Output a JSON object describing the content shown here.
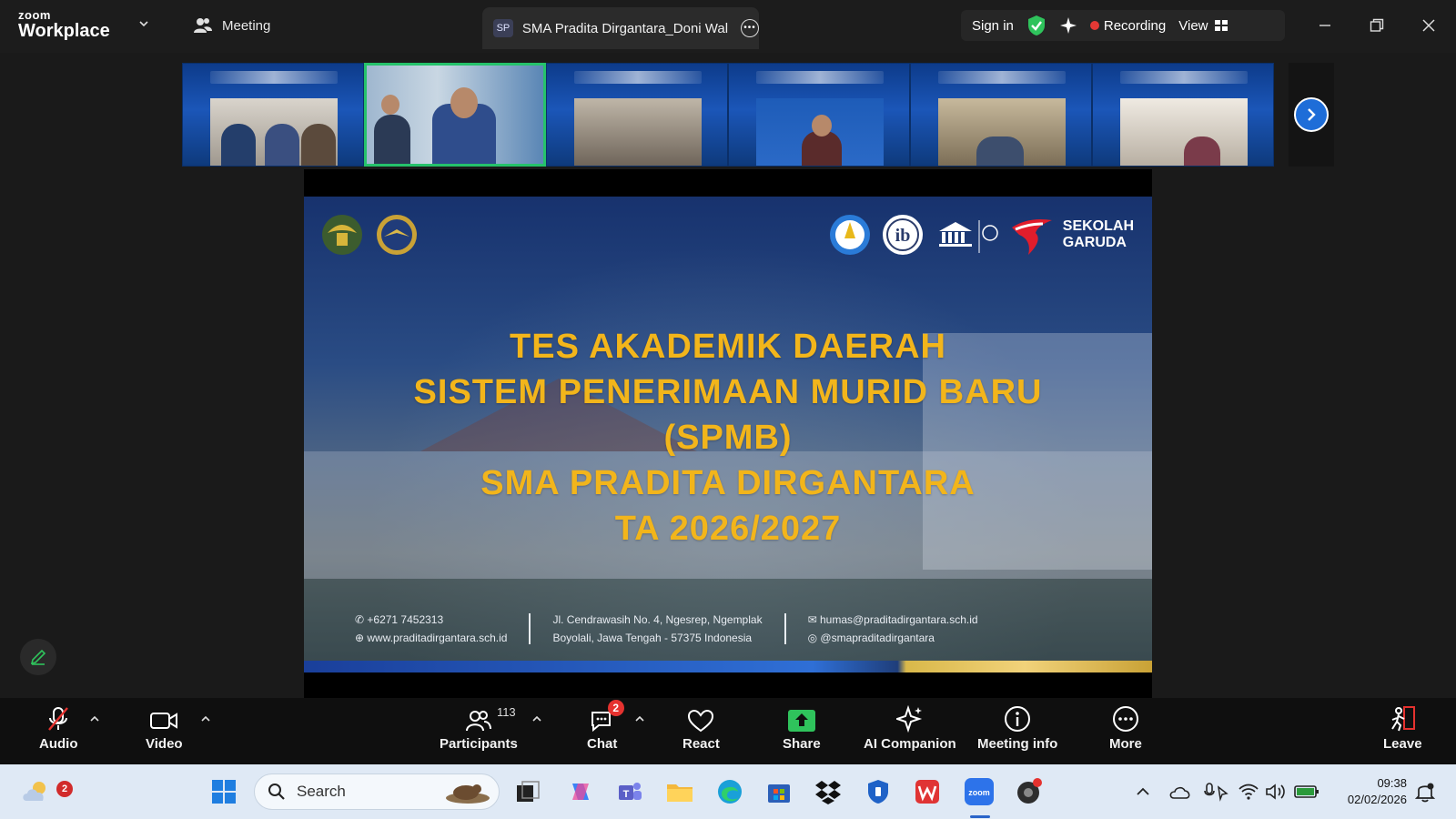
{
  "app": {
    "brand_top": "zoom",
    "brand_bottom": "Workplace",
    "meeting_tab_label": "Meeting",
    "meeting_title_badge": "SP",
    "meeting_title": "SMA Pradita Dirgantara_Doni Wal",
    "sign_in": "Sign in",
    "recording": "Recording",
    "view": "View",
    "accent": "#25c26b",
    "record_color": "#e53935"
  },
  "slide": {
    "title_lines": [
      "TES AKADEMIK DAERAH",
      "SISTEM PENERIMAAN MURID BARU",
      "(SPMB)",
      "SMA PRADITA DIRGANTARA",
      "TA 2026/2027"
    ],
    "title_color": "#f2b51b",
    "logo_right_text_1": "SEKOLAH",
    "logo_right_text_2": "GARUDA",
    "phone": "+6271 7452313",
    "website": "www.praditadirgantara.sch.id",
    "address_1": "Jl. Cendrawasih No. 4, Ngesrep, Ngemplak",
    "address_2": "Boyolali, Jawa Tengah - 57375 Indonesia",
    "email": "humas@praditadirgantara.sch.id",
    "social": "@smapraditadirgantara"
  },
  "toolbar": {
    "audio": "Audio",
    "video": "Video",
    "participants": "Participants",
    "participants_count": "113",
    "chat": "Chat",
    "chat_badge": "2",
    "react": "React",
    "share": "Share",
    "ai_companion": "AI Companion",
    "meeting_info": "Meeting info",
    "more": "More",
    "leave": "Leave"
  },
  "taskbar": {
    "weather_badge": "2",
    "search_placeholder": "Search",
    "time": "09:38",
    "date": "02/02/2026"
  }
}
